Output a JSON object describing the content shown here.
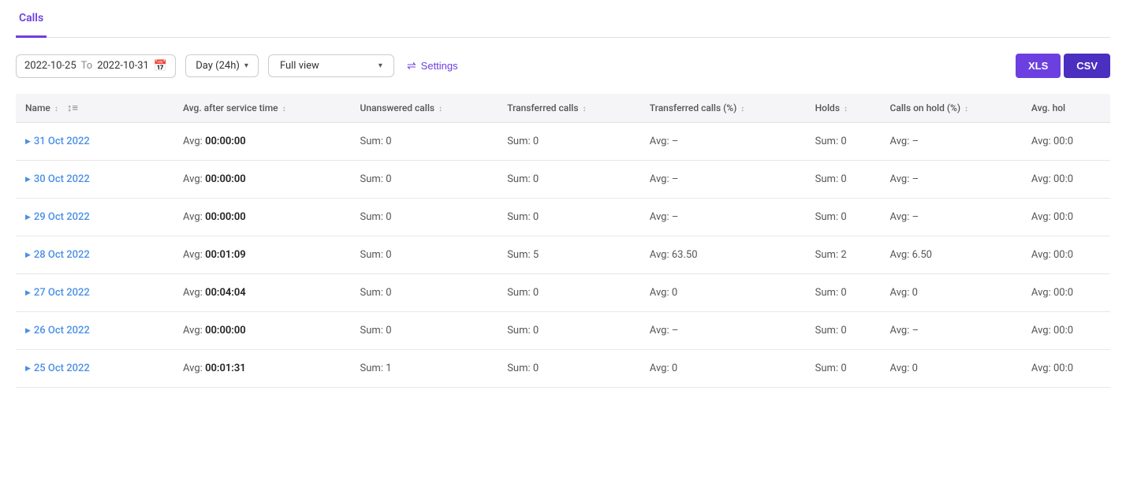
{
  "tabs": [
    {
      "label": "Calls",
      "active": true
    }
  ],
  "toolbar": {
    "date_from": "2022-10-25",
    "date_to": "2022-10-31",
    "to_label": "To",
    "day_option": "Day (24h)",
    "view_option": "Full view",
    "settings_label": "Settings",
    "xls_label": "XLS",
    "csv_label": "CSV"
  },
  "columns": [
    {
      "key": "name",
      "label": "Name"
    },
    {
      "key": "avg_after_service",
      "label": "Avg. after service time"
    },
    {
      "key": "unanswered",
      "label": "Unanswered calls"
    },
    {
      "key": "transferred",
      "label": "Transferred calls"
    },
    {
      "key": "transferred_pct",
      "label": "Transferred calls (%)"
    },
    {
      "key": "holds",
      "label": "Holds"
    },
    {
      "key": "calls_on_hold_pct",
      "label": "Calls on hold (%)"
    },
    {
      "key": "avg_hold",
      "label": "Avg. hol"
    }
  ],
  "rows": [
    {
      "name": "31 Oct 2022",
      "avg_after_service": "00:00:00",
      "unanswered": "0",
      "transferred": "0",
      "transferred_pct": "–",
      "holds": "0",
      "calls_on_hold_pct": "–",
      "avg_hold": "00:0"
    },
    {
      "name": "30 Oct 2022",
      "avg_after_service": "00:00:00",
      "unanswered": "0",
      "transferred": "0",
      "transferred_pct": "–",
      "holds": "0",
      "calls_on_hold_pct": "–",
      "avg_hold": "00:0"
    },
    {
      "name": "29 Oct 2022",
      "avg_after_service": "00:00:00",
      "unanswered": "0",
      "transferred": "0",
      "transferred_pct": "–",
      "holds": "0",
      "calls_on_hold_pct": "–",
      "avg_hold": "00:0"
    },
    {
      "name": "28 Oct 2022",
      "avg_after_service": "00:01:09",
      "unanswered": "0",
      "transferred": "5",
      "transferred_pct": "63.50",
      "holds": "2",
      "calls_on_hold_pct": "6.50",
      "avg_hold": "00:0"
    },
    {
      "name": "27 Oct 2022",
      "avg_after_service": "00:04:04",
      "unanswered": "0",
      "transferred": "0",
      "transferred_pct": "0",
      "holds": "0",
      "calls_on_hold_pct": "0",
      "avg_hold": "00:0"
    },
    {
      "name": "26 Oct 2022",
      "avg_after_service": "00:00:00",
      "unanswered": "0",
      "transferred": "0",
      "transferred_pct": "–",
      "holds": "0",
      "calls_on_hold_pct": "–",
      "avg_hold": "00:0"
    },
    {
      "name": "25 Oct 2022",
      "avg_after_service": "00:01:31",
      "unanswered": "1",
      "transferred": "0",
      "transferred_pct": "0",
      "holds": "0",
      "calls_on_hold_pct": "0",
      "avg_hold": "00:0"
    }
  ],
  "icons": {
    "expand": "▶",
    "calendar": "📅",
    "dropdown_arrow": "▾",
    "sort": "↕",
    "settings_sliders": "⇌"
  }
}
